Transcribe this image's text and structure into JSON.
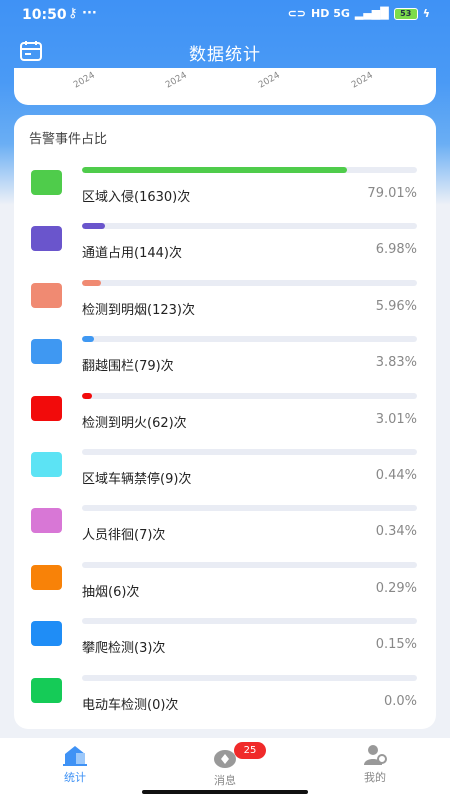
{
  "status": {
    "time": "10:50",
    "left_icons": "⚷ ···",
    "network": "HD 5G",
    "battery": "53"
  },
  "header": {
    "title": "数据统计"
  },
  "top_card": {
    "ticks": [
      "2024",
      "2024",
      "2024",
      "2024"
    ]
  },
  "card": {
    "title": "告警事件占比",
    "items": [
      {
        "label": "区域入侵(1630)次",
        "percent": "79.01%",
        "value": 79.01,
        "color": "#4fcc4b"
      },
      {
        "label": "通道占用(144)次",
        "percent": "6.98%",
        "value": 6.98,
        "color": "#6a55cc"
      },
      {
        "label": "检测到明烟(123)次",
        "percent": "5.96%",
        "value": 5.96,
        "color": "#f08a72"
      },
      {
        "label": "翻越围栏(79)次",
        "percent": "3.83%",
        "value": 3.83,
        "color": "#3f98f2"
      },
      {
        "label": "检测到明火(62)次",
        "percent": "3.01%",
        "value": 3.01,
        "color": "#f20b0b"
      },
      {
        "label": "区域车辆禁停(9)次",
        "percent": "0.44%",
        "value": 0.44,
        "color": "#5ce3f4"
      },
      {
        "label": "人员徘徊(7)次",
        "percent": "0.34%",
        "value": 0.34,
        "color": "#d877d6"
      },
      {
        "label": "抽烟(6)次",
        "percent": "0.29%",
        "value": 0.29,
        "color": "#f88208"
      },
      {
        "label": "攀爬检测(3)次",
        "percent": "0.15%",
        "value": 0.15,
        "color": "#1f8df6"
      },
      {
        "label": "电动车检测(0)次",
        "percent": "0.0%",
        "value": 0.0,
        "color": "#15cb57"
      }
    ]
  },
  "tabs": [
    {
      "label": "统计",
      "active": true
    },
    {
      "label": "消息",
      "active": false,
      "badge": "25"
    },
    {
      "label": "我的",
      "active": false
    }
  ],
  "colors": {
    "accent": "#3f92f5",
    "badge": "#f02a2a"
  }
}
